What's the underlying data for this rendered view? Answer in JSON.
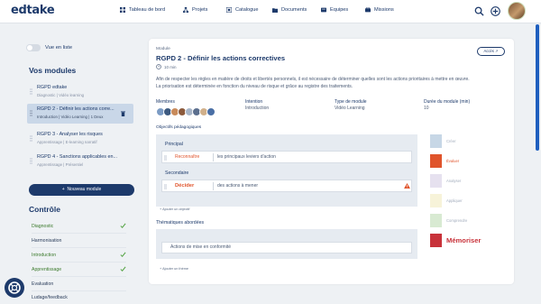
{
  "app": {
    "logo": "edtake"
  },
  "nav": [
    {
      "label": "Tableau de bord",
      "icon": "dashboard-icon"
    },
    {
      "label": "Projets",
      "icon": "projects-icon"
    },
    {
      "label": "Catalogue",
      "icon": "catalog-icon"
    },
    {
      "label": "Documents",
      "icon": "documents-icon"
    },
    {
      "label": "Equipes",
      "icon": "teams-icon"
    },
    {
      "label": "Missions",
      "icon": "missions-icon"
    }
  ],
  "sidebar": {
    "toggle_label": "Vue en liste",
    "modules_title": "Vos modules",
    "modules": [
      {
        "title": "RGPD edtake",
        "subtitle": "Diagnostic | Vidéo learning"
      },
      {
        "title": "RGPD 2 - Définir les actions corre...",
        "subtitle": "Introduction | Vidéo Learning | 1 Deux"
      },
      {
        "title": "RGPD 3 - Analyser les risques",
        "subtitle": "Apprentissage | E-learning narratif"
      },
      {
        "title": "RGPD 4 - Sanctions applicables en...",
        "subtitle": "Apprentissage | Présentiel"
      }
    ],
    "new_module_label": "Nouveau module",
    "control_title": "Contrôle",
    "control_items": [
      {
        "label": "Diagnostic",
        "done": true
      },
      {
        "label": "Harmonisation",
        "done": false
      },
      {
        "label": "Introduction",
        "done": true
      },
      {
        "label": "Apprentissage",
        "done": true
      },
      {
        "label": "Evaluation",
        "done": false
      },
      {
        "label": "Ludage/feedback",
        "done": false
      }
    ]
  },
  "card": {
    "kind_label": "Module",
    "title": "RGPD 2 - Définir les actions correctives",
    "duration": "10 min",
    "access_label": "Accès",
    "description_1": "Afin de respecter les règles en matière de droits et libertés personnels, il est nécessaire de déterminer quelles sont les actions prioritaires à mettre en œuvre.",
    "description_2": "La priorisation est déterminée en fonction du niveau de risque et grâce au registre des traitements.",
    "meta": {
      "members_label": "Membres",
      "intention_label": "Intention",
      "intention_value": "Introduction",
      "type_label": "Type de module",
      "type_value": "Vidéo Learning",
      "length_label": "Durée du module (min)",
      "length_value": "10"
    },
    "objectives_title": "Objectifs pédagogiques",
    "principal_label": "Principal",
    "principal": {
      "verb": "Reconnaître",
      "text": "les principaux leviers d'action"
    },
    "secondary_label": "Secondaire",
    "secondary": {
      "verb": "Décider",
      "text": "des actions à mener"
    },
    "add_objective": "+ Ajouter un objectif",
    "themes_title": "Thématiques abordées",
    "theme": "Actions de mise en conformité",
    "add_theme": "+ Ajouter un thème"
  },
  "taxonomy": [
    {
      "label": "Créer",
      "color": "#c7d7e6"
    },
    {
      "label": "Évaluer",
      "color": "#e0542c"
    },
    {
      "label": "Analyser",
      "color": "#e6e1ef"
    },
    {
      "label": "Appliquer",
      "color": "#f7f3d9"
    },
    {
      "label": "Comprendre",
      "color": "#d8ead2"
    },
    {
      "label": "Mémoriser",
      "color": "#c8323a"
    }
  ]
}
